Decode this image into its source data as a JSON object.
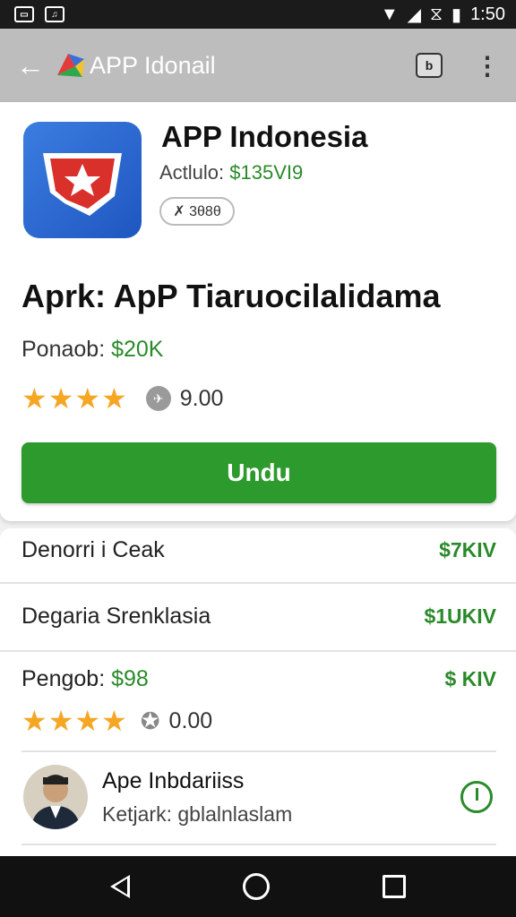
{
  "status_bar": {
    "time": "1:50",
    "left_icons": [
      "notification-icon",
      "sim-icon"
    ],
    "right_icons": [
      "wifi-icon",
      "signal-icon",
      "vibrate-icon",
      "battery-icon"
    ]
  },
  "app_bar": {
    "title": "APP Idonail",
    "back_icon": "arrow-left-icon",
    "store_icon_glyph": "b",
    "more_icon": "more-vert-icon"
  },
  "app_header": {
    "name": "APP Indonesia",
    "sub_prefix": "Actlulo: ",
    "sub_value": "$135VI9",
    "chip": "✗ 3θ8θ"
  },
  "detail": {
    "headline": "Aprk: ApP Tiaruocilalidama",
    "price_prefix": "Ponaob: ",
    "price_value": "$20K",
    "stars": "★★★★",
    "rating_value": "9.00",
    "download_label": "Undu"
  },
  "list": {
    "rows": [
      {
        "label": "Denorri i Ceak",
        "value": "$7KIV"
      },
      {
        "label": "Degaria Srenklasia",
        "value": "$1UKIV"
      },
      {
        "label_prefix": "Pengob: ",
        "label_value": "$98",
        "value": "$ KIV"
      }
    ],
    "rating_stars": "★★★★",
    "rating_value": "0.00",
    "developer_name": "Ape Inbdariiss",
    "developer_sub_prefix": "Ketjark: ",
    "developer_sub_value": "gblalnlaslam"
  },
  "colors": {
    "accent_green": "#2c9a2c",
    "star_gold": "#f5a623",
    "app_bar_gray": "#bdbdbd"
  }
}
